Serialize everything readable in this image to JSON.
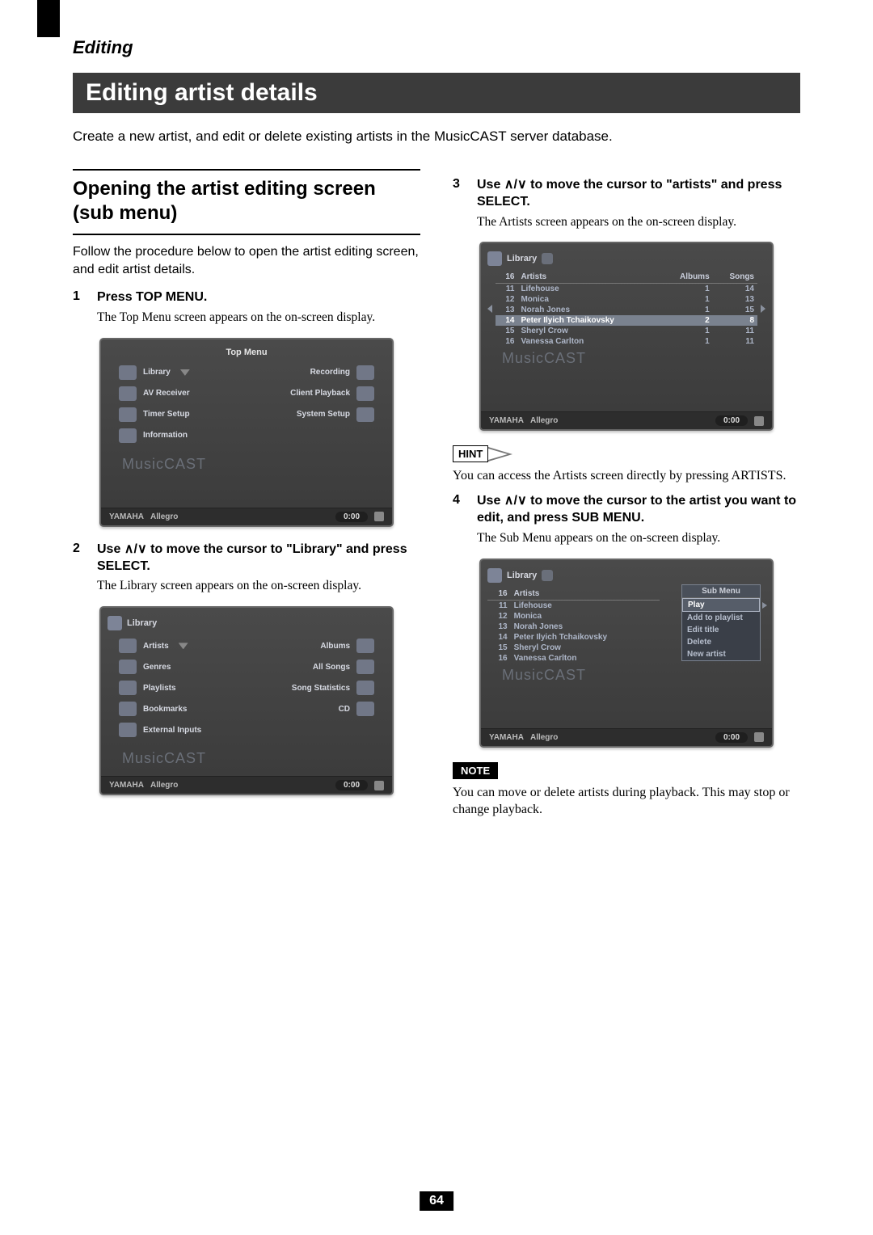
{
  "page_number": "64",
  "section_label": "Editing",
  "title": "Editing artist details",
  "intro": "Create a new artist, and edit or delete existing artists in the MusicCAST server database.",
  "left": {
    "sub_heading": "Opening the artist editing screen (sub menu)",
    "body": "Follow the procedure below to open the artist editing screen, and edit artist details.",
    "step1": {
      "num": "1",
      "title": "Press TOP MENU.",
      "body": "The Top Menu screen appears on the on-screen display."
    },
    "step2": {
      "num": "2",
      "title_pre": "Use ",
      "title_arrows": "∧/∨",
      "title_post": " to move the cursor to \"Library\" and press SELECT.",
      "body": "The Library screen appears on the on-screen display."
    }
  },
  "right": {
    "step3": {
      "num": "3",
      "title_pre": "Use ",
      "title_arrows": "∧/∨",
      "title_post": " to move the cursor to \"artists\" and press SELECT.",
      "body": "The Artists screen appears on the on-screen display."
    },
    "hint_label": "HINT",
    "hint_text": "You can access the Artists screen directly by pressing ARTISTS.",
    "step4": {
      "num": "4",
      "title_pre": "Use ",
      "title_arrows": "∧/∨",
      "title_post": " to move the cursor to the artist you want to edit, and press SUB MENU.",
      "body": "The Sub Menu appears on the on-screen display."
    },
    "note_label": "NOTE",
    "note_text": "You can move or delete artists during playback. This may stop or change playback."
  },
  "screens": {
    "brand": "YAMAHA",
    "track": "Allegro",
    "time": "0:00",
    "watermark": "MusicCAST",
    "topmenu": {
      "title": "Top Menu",
      "left_items": [
        "Library",
        "AV Receiver",
        "Timer Setup",
        "Information"
      ],
      "right_items": [
        "Recording",
        "Client Playback",
        "System Setup"
      ]
    },
    "library": {
      "crumb": "Library",
      "left_items": [
        "Artists",
        "Genres",
        "Playlists",
        "Bookmarks",
        "External Inputs"
      ],
      "right_items": [
        "Albums",
        "All Songs",
        "Song Statistics",
        "CD"
      ]
    },
    "artists": {
      "crumb": "Library",
      "count": "16",
      "heading": "Artists",
      "col_albums": "Albums",
      "col_songs": "Songs",
      "rows": [
        {
          "n": "11",
          "name": "Lifehouse",
          "a": "1",
          "s": "14"
        },
        {
          "n": "12",
          "name": "Monica",
          "a": "1",
          "s": "13"
        },
        {
          "n": "13",
          "name": "Norah Jones",
          "a": "1",
          "s": "15"
        },
        {
          "n": "14",
          "name": "Peter Ilyich Tchaikovsky",
          "a": "2",
          "s": "8",
          "hl": true
        },
        {
          "n": "15",
          "name": "Sheryl Crow",
          "a": "1",
          "s": "11"
        },
        {
          "n": "16",
          "name": "Vanessa Carlton",
          "a": "1",
          "s": "11"
        }
      ]
    },
    "submenu": {
      "title": "Sub Menu",
      "items": [
        "Play",
        "Add to playlist",
        "Edit title",
        "Delete",
        "New artist"
      ],
      "hl_index": 0,
      "rows": [
        {
          "n": "11",
          "name": "Lifehouse"
        },
        {
          "n": "12",
          "name": "Monica"
        },
        {
          "n": "13",
          "name": "Norah Jones"
        },
        {
          "n": "14",
          "name": "Peter Ilyich Tchaikovsky"
        },
        {
          "n": "15",
          "name": "Sheryl Crow"
        },
        {
          "n": "16",
          "name": "Vanessa Carlton"
        }
      ]
    }
  }
}
